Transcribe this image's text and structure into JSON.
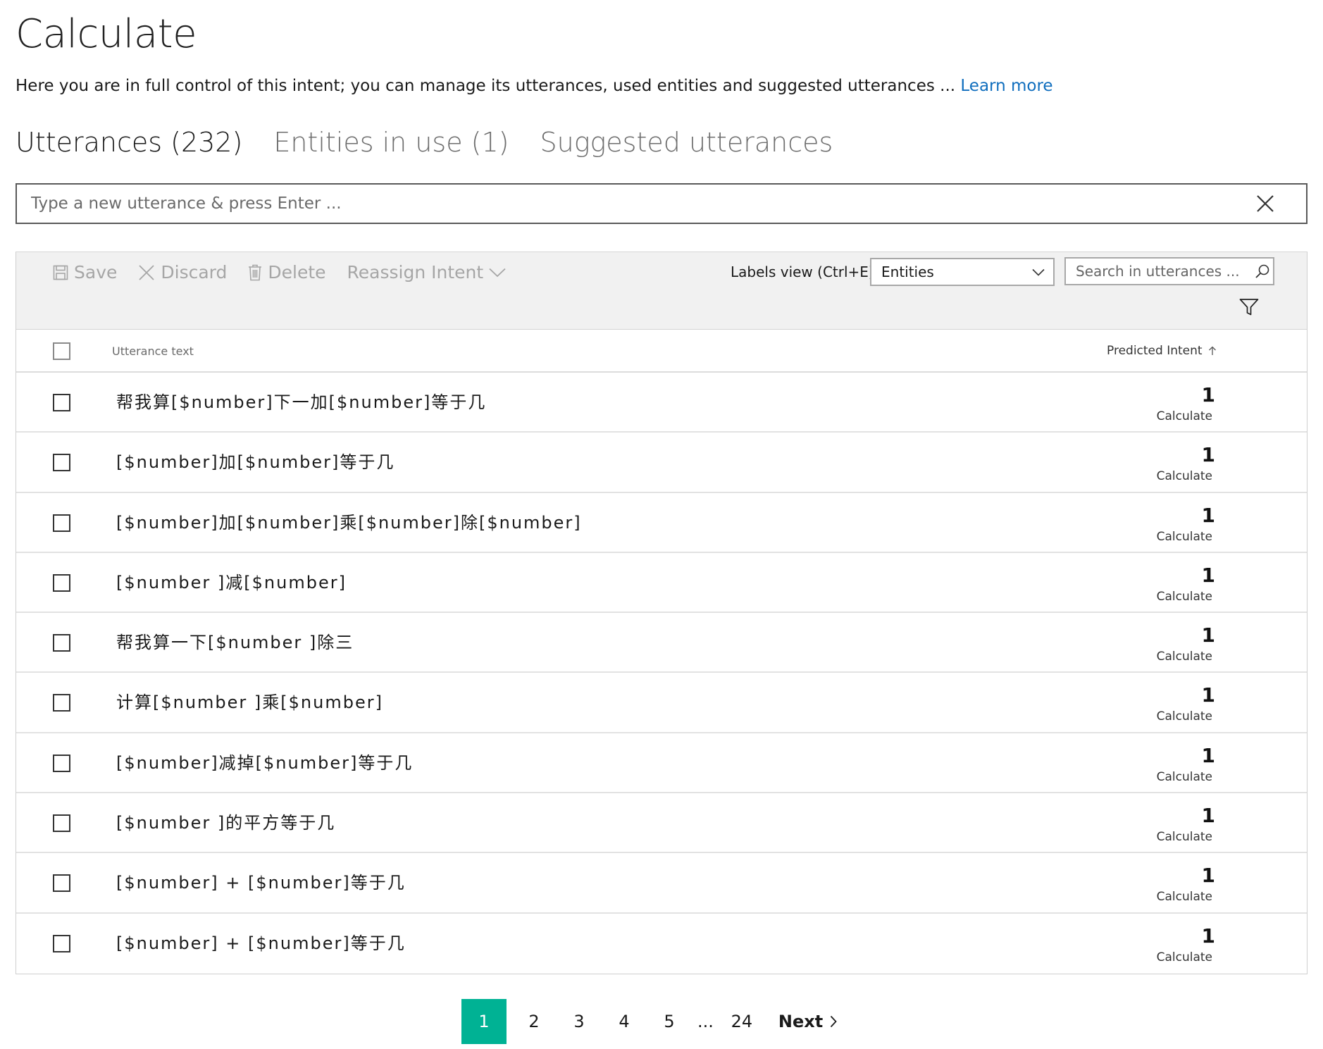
{
  "page": {
    "title": "Calculate",
    "description": "Here you are in full control of this intent; you can manage its utterances, used entities and suggested utterances ...",
    "learn_more": "Learn more"
  },
  "tabs": [
    {
      "label": "Utterances (232)",
      "active": true
    },
    {
      "label": "Entities in use (1)",
      "active": false
    },
    {
      "label": "Suggested utterances",
      "active": false
    }
  ],
  "new_utterance": {
    "placeholder": "Type a new utterance & press Enter ..."
  },
  "toolbar": {
    "save": "Save",
    "discard": "Discard",
    "delete": "Delete",
    "reassign": "Reassign Intent",
    "labels_view_label": "Labels view (Ctrl+E):",
    "labels_view_value": "Entities",
    "search_placeholder": "Search in utterances ..."
  },
  "table": {
    "col_text": "Utterance text",
    "col_intent": "Predicted Intent",
    "rows": [
      {
        "text": "帮我算[$number]下一加[$number]等于几",
        "score": "1",
        "intent": "Calculate"
      },
      {
        "text": "[$number]加[$number]等于几",
        "score": "1",
        "intent": "Calculate"
      },
      {
        "text": "[$number]加[$number]乘[$number]除[$number]",
        "score": "1",
        "intent": "Calculate"
      },
      {
        "text": "[$number ]减[$number]",
        "score": "1",
        "intent": "Calculate"
      },
      {
        "text": "帮我算一下[$number ]除三",
        "score": "1",
        "intent": "Calculate"
      },
      {
        "text": "计算[$number ]乘[$number]",
        "score": "1",
        "intent": "Calculate"
      },
      {
        "text": "[$number]减掉[$number]等于几",
        "score": "1",
        "intent": "Calculate"
      },
      {
        "text": "[$number ]的平方等于几",
        "score": "1",
        "intent": "Calculate"
      },
      {
        "text": "[$number] + [$number]等于几",
        "score": "1",
        "intent": "Calculate"
      },
      {
        "text": "[$number] + [$number]等于几",
        "score": "1",
        "intent": "Calculate"
      }
    ]
  },
  "pagination": {
    "pages": [
      "1",
      "2",
      "3",
      "4",
      "5"
    ],
    "ellipsis": "...",
    "last": "24",
    "next": "Next",
    "current": "1"
  },
  "colors": {
    "accent": "#00b294",
    "link": "#106ebe"
  }
}
